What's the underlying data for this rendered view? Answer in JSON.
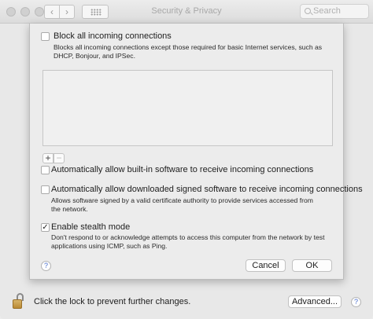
{
  "window": {
    "title": "Security & Privacy",
    "search_placeholder": "Search",
    "back_glyph": "‹",
    "forward_glyph": "›"
  },
  "firewall_options": {
    "block_all": {
      "label": "Block all incoming connections",
      "checked": false,
      "description_line1": "Blocks all incoming connections except those required for basic Internet services, such as",
      "description_line2": "DHCP, Bonjour, and IPSec."
    },
    "app_list": [],
    "add_glyph": "+",
    "remove_glyph": "−",
    "auto_builtin": {
      "label": "Automatically allow built-in software to receive incoming connections",
      "checked": false
    },
    "auto_signed": {
      "label": "Automatically allow downloaded signed software to receive incoming connections",
      "checked": false,
      "description_line1": "Allows software signed by a valid certificate authority to provide services accessed from",
      "description_line2": "the network."
    },
    "stealth": {
      "label": "Enable stealth mode",
      "checked": true,
      "check_glyph": "✓",
      "description_line1": "Don't respond to or acknowledge attempts to access this computer from the network by test",
      "description_line2": "applications using ICMP, such as Ping."
    },
    "help_glyph": "?",
    "cancel_label": "Cancel",
    "ok_label": "OK"
  },
  "footer": {
    "lock_text": "Click the lock to prevent further changes.",
    "advanced_label": "Advanced...",
    "help_glyph": "?"
  },
  "icons": [
    "close-icon",
    "minimize-icon",
    "zoom-icon",
    "back-icon",
    "forward-icon",
    "show-all-grid-icon",
    "search-icon",
    "lock-icon",
    "help-icon"
  ]
}
